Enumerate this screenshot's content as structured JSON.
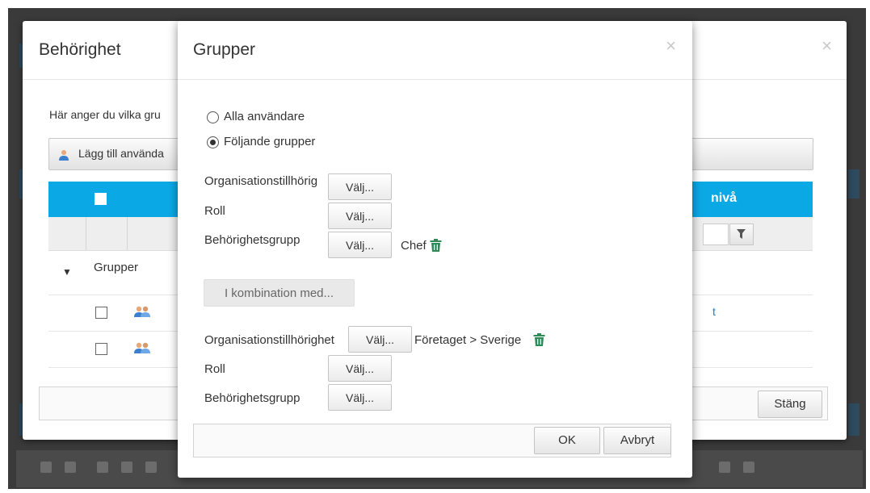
{
  "outer_dialog": {
    "title": "Behörighet",
    "close_glyph": "×",
    "description": "Här anger du vilka gru",
    "add_button_label": "Lägg till använda",
    "table": {
      "column_header_right": "nivå",
      "group_label": "Grupper",
      "row_link": "t"
    },
    "close_button_label": "Stäng"
  },
  "inner_dialog": {
    "title": "Grupper",
    "close_glyph": "×",
    "radio_all_label": "Alla användare",
    "radio_following_label": "Följande grupper",
    "radio_selected": "following",
    "section1": {
      "org_label": "Organisationstillhörig",
      "role_label": "Roll",
      "group_label": "Behörighetsgrupp",
      "choose_label": "Välj...",
      "group_selected": "Chef"
    },
    "combine_button_label": "I kombination med...",
    "section2": {
      "org_label": "Organisationstillhörighet",
      "role_label": "Roll",
      "group_label": "Behörighetsgrupp",
      "choose_label": "Välj...",
      "org_selected": "Företaget > Sverige"
    },
    "ok_label": "OK",
    "cancel_label": "Avbryt"
  },
  "icons": {
    "trash": "trash-icon",
    "person": "person-icon",
    "group": "group-icon",
    "filter": "filter-icon",
    "chevron": "chevron-down-icon"
  },
  "colors": {
    "table_header": "#0aa9e6",
    "trash_green": "#2e8b57",
    "link_blue": "#1a7fc0"
  }
}
